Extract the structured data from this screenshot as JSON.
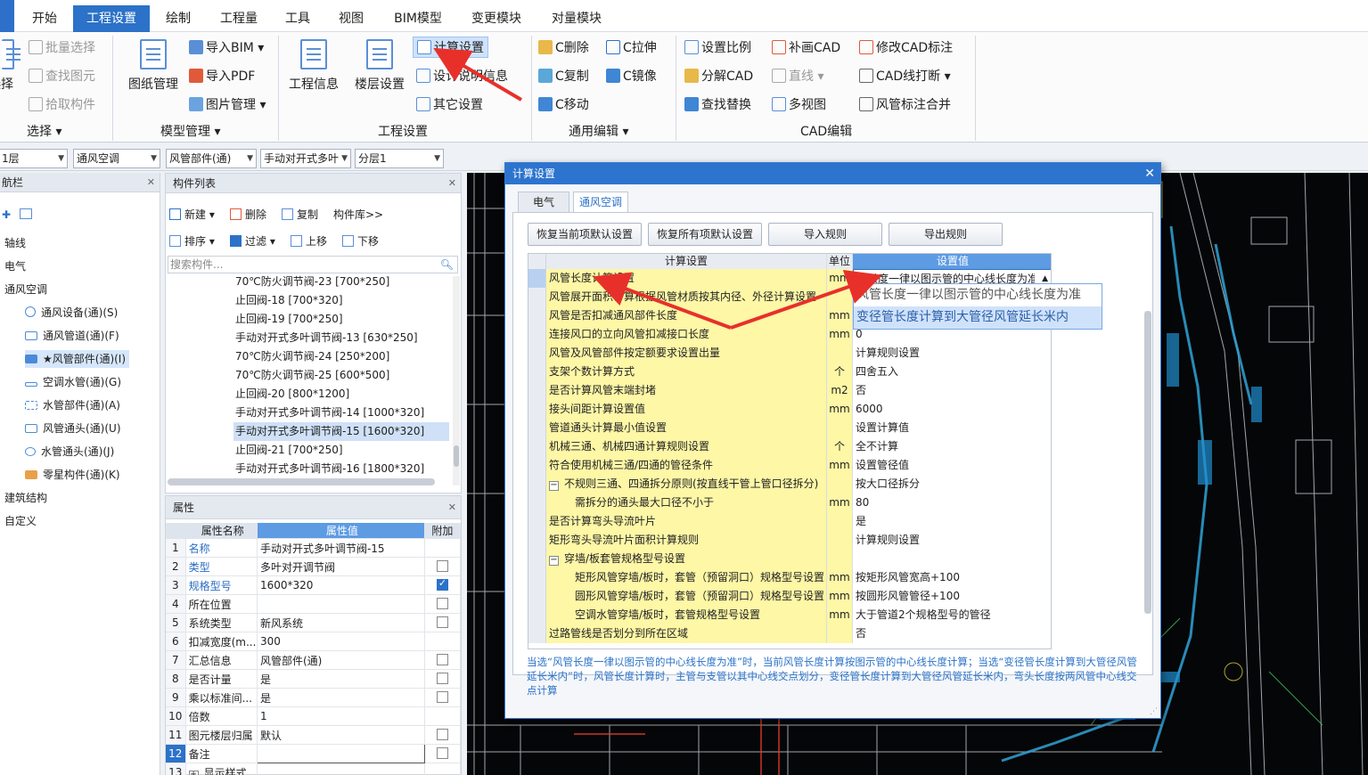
{
  "menubar": {
    "tabs": [
      "开始",
      "工程设置",
      "绘制",
      "工程量",
      "工具",
      "视图",
      "BIM模型",
      "变更模块",
      "对量模块"
    ],
    "active_index": 1
  },
  "ribbon": {
    "select_group": {
      "label": "选择",
      "batch_select": "批量选择",
      "find_element": "查找图元",
      "pick_component": "拾取构件",
      "select": "选择"
    },
    "model_group": {
      "label": "模型管理",
      "drawing_mgmt": "图纸管理",
      "import_bim": "导入BIM",
      "import_pdf": "导入PDF",
      "image_mgmt": "图片管理"
    },
    "project_group": {
      "label": "工程设置",
      "project_info": "工程信息",
      "floor_settings": "楼层设置",
      "calc_settings": "计算设置",
      "design_notes": "设计说明信息",
      "other_settings": "其它设置"
    },
    "edit_group": {
      "label": "通用编辑",
      "c_delete": "C删除",
      "c_stretch": "C拉伸",
      "c_copy": "C复制",
      "c_mirror": "C镜像",
      "c_move": "C移动"
    },
    "cad_group": {
      "label": "CAD编辑",
      "set_scale": "设置比例",
      "add_cad": "补画CAD",
      "modify_cad_label": "修改CAD标注",
      "split_cad": "分解CAD",
      "line": "直线",
      "cad_line_break": "CAD线打断",
      "find_replace": "查找替换",
      "multi_view": "多视图",
      "duct_label_merge": "风管标注合并"
    }
  },
  "selectors": [
    "1层",
    "通风空调",
    "风管部件(通)",
    "手动对开式多叶",
    "分层1"
  ],
  "nav": {
    "title": "航栏",
    "items": [
      "轴线",
      "电气",
      "通风空调",
      "建筑结构",
      "自定义"
    ],
    "hvac_children": [
      "通风设备(通)(S)",
      "通风管道(通)(F)",
      "★风管部件(通)(I)",
      "空调水管(通)(G)",
      "水管部件(通)(A)",
      "风管通头(通)(U)",
      "水管通头(通)(J)",
      "零星构件(通)(K)"
    ],
    "selected_child": 2
  },
  "component_list": {
    "title": "构件列表",
    "toolbar1": {
      "new": "新建",
      "delete": "删除",
      "copy": "复制",
      "library": "构件库>>"
    },
    "toolbar2": {
      "sort": "排序",
      "filter": "过滤",
      "up": "上移",
      "down": "下移"
    },
    "search_placeholder": "搜索构件...",
    "rows": [
      "70℃防火调节阀-23 [700*250]",
      "止回阀-18 [700*320]",
      "止回阀-19 [700*250]",
      "手动对开式多叶调节阀-13 [630*250]",
      "70℃防火调节阀-24 [250*200]",
      "70℃防火调节阀-25 [600*500]",
      "止回阀-20 [800*1200]",
      "手动对开式多叶调节阀-14 [1000*320]",
      "手动对开式多叶调节阀-15 [1600*320]",
      "止回阀-21 [700*250]",
      "手动对开式多叶调节阀-16 [1800*320]"
    ],
    "selected_row": 8
  },
  "properties": {
    "title": "属性",
    "headers": [
      "属性名称",
      "属性值",
      "附加"
    ],
    "rows": [
      {
        "num": "1",
        "name": "名称",
        "value": "手动对开式多叶调节阀-15",
        "blue": true,
        "check": null
      },
      {
        "num": "2",
        "name": "类型",
        "value": "多叶对开调节阀",
        "blue": true,
        "check": false
      },
      {
        "num": "3",
        "name": "规格型号",
        "value": "1600*320",
        "blue": true,
        "check": true
      },
      {
        "num": "4",
        "name": "所在位置",
        "value": "",
        "blue": false,
        "check": false
      },
      {
        "num": "5",
        "name": "系统类型",
        "value": "新风系统",
        "blue": false,
        "check": false
      },
      {
        "num": "6",
        "name": "扣减宽度(m...",
        "value": "300",
        "blue": false,
        "check": null
      },
      {
        "num": "7",
        "name": "汇总信息",
        "value": "风管部件(通)",
        "blue": false,
        "check": false
      },
      {
        "num": "8",
        "name": "是否计量",
        "value": "是",
        "blue": false,
        "check": false
      },
      {
        "num": "9",
        "name": "乘以标准间...",
        "value": "是",
        "blue": false,
        "check": false
      },
      {
        "num": "10",
        "name": "倍数",
        "value": "1",
        "blue": false,
        "check": null
      },
      {
        "num": "11",
        "name": "图元楼层归属",
        "value": "默认",
        "blue": false,
        "check": false
      },
      {
        "num": "12",
        "name": "备注",
        "value": "",
        "blue": false,
        "check": false
      },
      {
        "num": "13",
        "name": "显示样式",
        "value": "",
        "blue": false,
        "check": null
      }
    ]
  },
  "dialog": {
    "title": "计算设置",
    "tabs": [
      "电气",
      "通风空调"
    ],
    "active_tab": 1,
    "buttons": [
      "恢复当前项默认设置",
      "恢复所有项默认设置",
      "导入规则",
      "导出规则"
    ],
    "headers": [
      "计算设置",
      "单位",
      "设置值"
    ],
    "rows": [
      {
        "name": "风管长度计算设置",
        "unit": "mm",
        "value": "管长度一律以图示管的中心线长度为准",
        "level": 0,
        "sel": true
      },
      {
        "name": "风管展开面积计算根据风管材质按其内径、外径计算设置",
        "unit": "",
        "value": "",
        "level": 0
      },
      {
        "name": "风管是否扣减通风部件长度",
        "unit": "mm",
        "value": "",
        "level": 0
      },
      {
        "name": "连接风口的立向风管扣减接口长度",
        "unit": "mm",
        "value": "0",
        "level": 0
      },
      {
        "name": "风管及风管部件按定额要求设置出量",
        "unit": "",
        "value": "计算规则设置",
        "level": 0
      },
      {
        "name": "支架个数计算方式",
        "unit": "个",
        "value": "四舍五入",
        "level": 0
      },
      {
        "name": "是否计算风管末端封堵",
        "unit": "m2",
        "value": "否",
        "level": 0
      },
      {
        "name": "接头间距计算设置值",
        "unit": "mm",
        "value": "6000",
        "level": 0
      },
      {
        "name": "管道通头计算最小值设置",
        "unit": "",
        "value": "设置计算值",
        "level": 0
      },
      {
        "name": "机械三通、机械四通计算规则设置",
        "unit": "个",
        "value": "全不计算",
        "level": 0
      },
      {
        "name": "符合使用机械三通/四通的管径条件",
        "unit": "mm",
        "value": "设置管径值",
        "level": 0
      },
      {
        "name": "不规则三通、四通拆分原则(按直线干管上管口径拆分)",
        "unit": "",
        "value": "按大口径拆分",
        "level": 0,
        "expander": true
      },
      {
        "name": "需拆分的通头最大口径不小于",
        "unit": "mm",
        "value": "80",
        "level": 2
      },
      {
        "name": "是否计算弯头导流叶片",
        "unit": "",
        "value": "是",
        "level": 0
      },
      {
        "name": "矩形弯头导流叶片面积计算规则",
        "unit": "",
        "value": "计算规则设置",
        "level": 0
      },
      {
        "name": "穿墙/板套管规格型号设置",
        "unit": "",
        "value": "",
        "level": 0,
        "expander": true
      },
      {
        "name": "矩形风管穿墙/板时，套管（预留洞口）规格型号设置",
        "unit": "mm",
        "value": "按矩形风管宽高+100",
        "level": 2
      },
      {
        "name": "圆形风管穿墙/板时，套管（预留洞口）规格型号设置",
        "unit": "mm",
        "value": "按圆形风管管径+100",
        "level": 2
      },
      {
        "name": "空调水管穿墙/板时，套管规格型号设置",
        "unit": "mm",
        "value": "大于管道2个规格型号的管径",
        "level": 2
      },
      {
        "name": "过路管线是否划分到所在区域",
        "unit": "",
        "value": "否",
        "level": 0
      }
    ],
    "dropdown_options": [
      "风管长度一律以图示管的中心线长度为准",
      "变径管长度计算到大管径风管延长米内"
    ],
    "dropdown_hover_index": 1,
    "note": "当选“风管长度一律以图示管的中心线长度为准”时，当前风管长度计算按图示管的中心线长度计算；当选“变径管长度计算到大管径风管延长米内”时，风管长度计算时，主管与支管以其中心线交点划分，变径管长度计算到大管径风管延长米内，弯头长度按两风管中心线交点计算"
  },
  "colors": {
    "accent": "#2b72c8",
    "yellow_cell": "#fdf7a6",
    "header_blue": "#5d9be3",
    "arrow_red": "#e8302a"
  }
}
